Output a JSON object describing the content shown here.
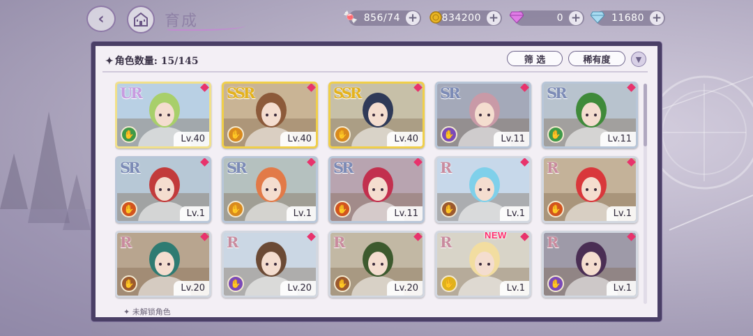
{
  "header": {
    "title": "育成",
    "back_icon": "back-arrow-icon",
    "home_icon": "castle-home-icon"
  },
  "currencies": [
    {
      "name": "candy",
      "icon": "candy-icon",
      "value": "856/74",
      "color": "#e2516e"
    },
    {
      "name": "gold",
      "icon": "gold-coin-icon",
      "value": "834200",
      "color": "#e9b524"
    },
    {
      "name": "pink-gem",
      "icon": "pink-gem-icon",
      "value": "0",
      "color": "#d66be0"
    },
    {
      "name": "diamond",
      "icon": "diamond-icon",
      "value": "11680",
      "color": "#8ed0ee"
    }
  ],
  "panel": {
    "count_label": "角色数量: 15/145",
    "filter_label": "筛 选",
    "rarity_label": "稀有度",
    "new_badge": "NEW",
    "next_section_label": "✦ 未解锁角色"
  },
  "characters": [
    {
      "rarity": "UR",
      "level": "Lv.40",
      "attr_color": "#3f9a48",
      "hair": "#a8cf6a",
      "bg": "#b9d0e4"
    },
    {
      "rarity": "SSR",
      "level": "Lv.40",
      "attr_color": "#d98a1d",
      "hair": "#8c5a3a",
      "bg": "#c9b495"
    },
    {
      "rarity": "SSR",
      "level": "Lv.40",
      "attr_color": "#d98a1d",
      "hair": "#2f3a58",
      "bg": "#c7c0a8"
    },
    {
      "rarity": "SR",
      "level": "Lv.11",
      "attr_color": "#7b4ab8",
      "hair": "#c99aa7",
      "bg": "#a4a9b9"
    },
    {
      "rarity": "SR",
      "level": "Lv.11",
      "attr_color": "#3f9a48",
      "hair": "#3f8a3a",
      "bg": "#b8c3ce"
    },
    {
      "rarity": "SR",
      "level": "Lv.1",
      "attr_color": "#d2541e",
      "hair": "#c23b3b",
      "bg": "#b7c8d6"
    },
    {
      "rarity": "SR",
      "level": "Lv.1",
      "attr_color": "#d98a1d",
      "hair": "#e27a48",
      "bg": "#b5c1bf"
    },
    {
      "rarity": "SR",
      "level": "Lv.11",
      "attr_color": "#d2541e",
      "hair": "#c2304e",
      "bg": "#b8a4b0"
    },
    {
      "rarity": "R",
      "level": "Lv.1",
      "attr_color": "#9c5a2e",
      "hair": "#7fd0ea",
      "bg": "#c7d8ea"
    },
    {
      "rarity": "R",
      "level": "Lv.1",
      "attr_color": "#d2541e",
      "hair": "#d9373b",
      "bg": "#c4b299"
    },
    {
      "rarity": "R",
      "level": "Lv.20",
      "attr_color": "#9c5a2e",
      "hair": "#2e7b72",
      "bg": "#b8a58f"
    },
    {
      "rarity": "R",
      "level": "Lv.20",
      "attr_color": "#7b4ab8",
      "hair": "#6b4a35",
      "bg": "#cbd7e4"
    },
    {
      "rarity": "R",
      "level": "Lv.20",
      "attr_color": "#9c5a2e",
      "hair": "#3d5a2e",
      "bg": "#c2b8a4"
    },
    {
      "rarity": "R",
      "level": "Lv.1",
      "attr_color": "#e0b21d",
      "hair": "#f2dda0",
      "bg": "#d8d4c8"
    },
    {
      "rarity": "R",
      "level": "Lv.1",
      "attr_color": "#7b4ab8",
      "hair": "#4a2e54",
      "bg": "#9e9aa8"
    }
  ]
}
